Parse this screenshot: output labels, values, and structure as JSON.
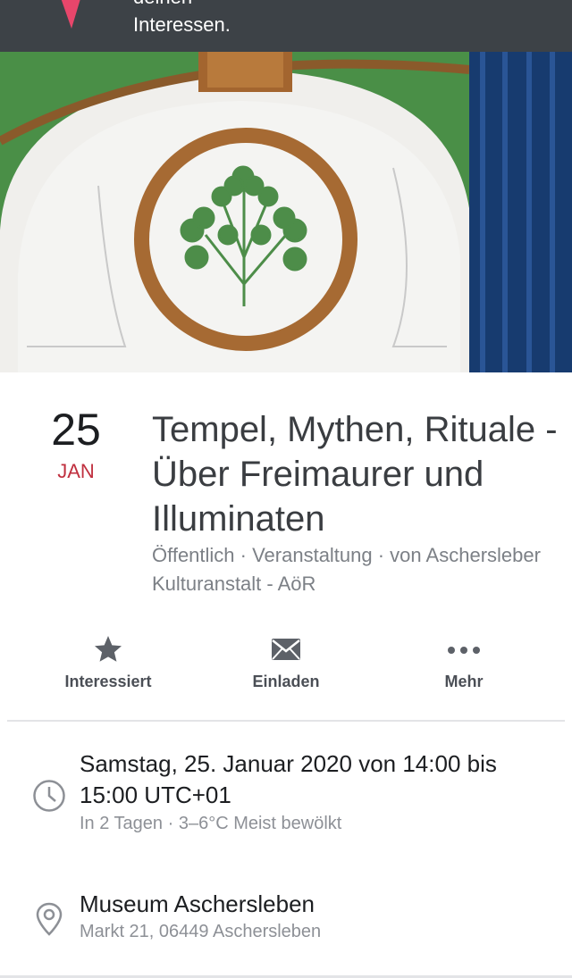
{
  "notification": {
    "line1": "deinen",
    "line2": "Interessen.",
    "pin_icon": "red-pin-icon",
    "background": "#3d4247"
  },
  "cover": {
    "description_icon": "cover-photo"
  },
  "event": {
    "day": "25",
    "month": "JAN",
    "title": "Tempel, Mythen, Rituale - Über Freimaurer und Illuminaten",
    "subtitle": "Öffentlich · Veranstaltung · von Aschersleber Kulturanstalt - AöR",
    "month_color": "#c0303f"
  },
  "actions": [
    {
      "label": "Interessiert",
      "icon": "star-icon"
    },
    {
      "label": "Einladen",
      "icon": "envelope-icon"
    },
    {
      "label": "Mehr",
      "icon": "more-dots-icon"
    }
  ],
  "details": {
    "time": {
      "main": "Samstag, 25. Januar 2020 von 14:00 bis 15:00 UTC+01",
      "sub": "In 2 Tagen · 3–6°C Meist bewölkt",
      "icon": "clock-icon"
    },
    "location": {
      "main": "Museum Aschersleben",
      "sub": "Markt 21, 06449 Aschersleben",
      "icon": "location-pin-icon"
    }
  }
}
